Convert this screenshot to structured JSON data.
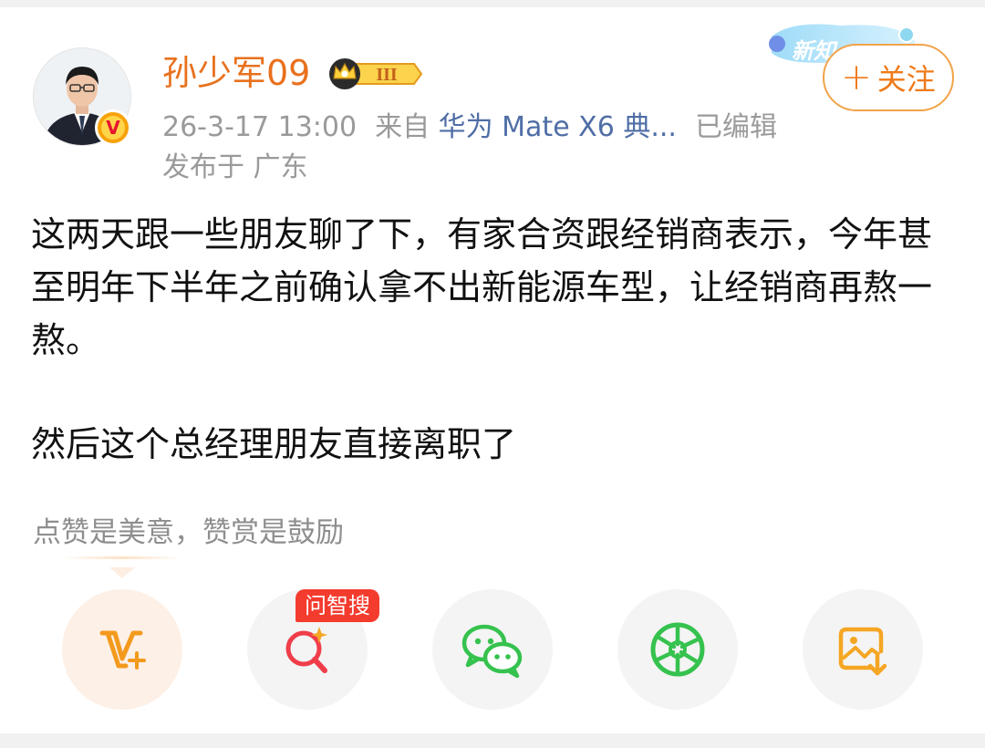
{
  "post": {
    "author": {
      "name": "孙少军09",
      "level_badge": "III",
      "verified_badge": "V"
    },
    "meta": {
      "time": "26-3-17 13:00",
      "source_prefix": "来自",
      "source_device": "华为 Mate X6 典...",
      "edited": "已编辑"
    },
    "location": "发布于 广东",
    "new_badge": "新知",
    "follow_button": {
      "plus": "+",
      "label": "关注"
    },
    "content": {
      "paragraph1": "这两天跟一些朋友聊了下，有家合资跟经销商表示，今年甚至明年下半年之前确认拿不出新能源车型，让经销商再熬一熬。",
      "paragraph2": "然后这个总经理朋友直接离职了"
    },
    "reward_text": "点赞是美意，赞赏是鼓励"
  },
  "actions": {
    "search_tag": "问智搜",
    "items": [
      {
        "icon": "v-plus-icon",
        "color": "#f39a1e"
      },
      {
        "icon": "ai-search-icon",
        "color": "#ef3e4a"
      },
      {
        "icon": "wechat-icon",
        "color": "#35c24e"
      },
      {
        "icon": "moments-icon",
        "color": "#35c24e"
      },
      {
        "icon": "save-image-icon",
        "color": "#f5a623"
      }
    ]
  },
  "colors": {
    "username": "#e8711d",
    "source_link": "#4f6ea6",
    "follow": "#ef7a1a"
  }
}
